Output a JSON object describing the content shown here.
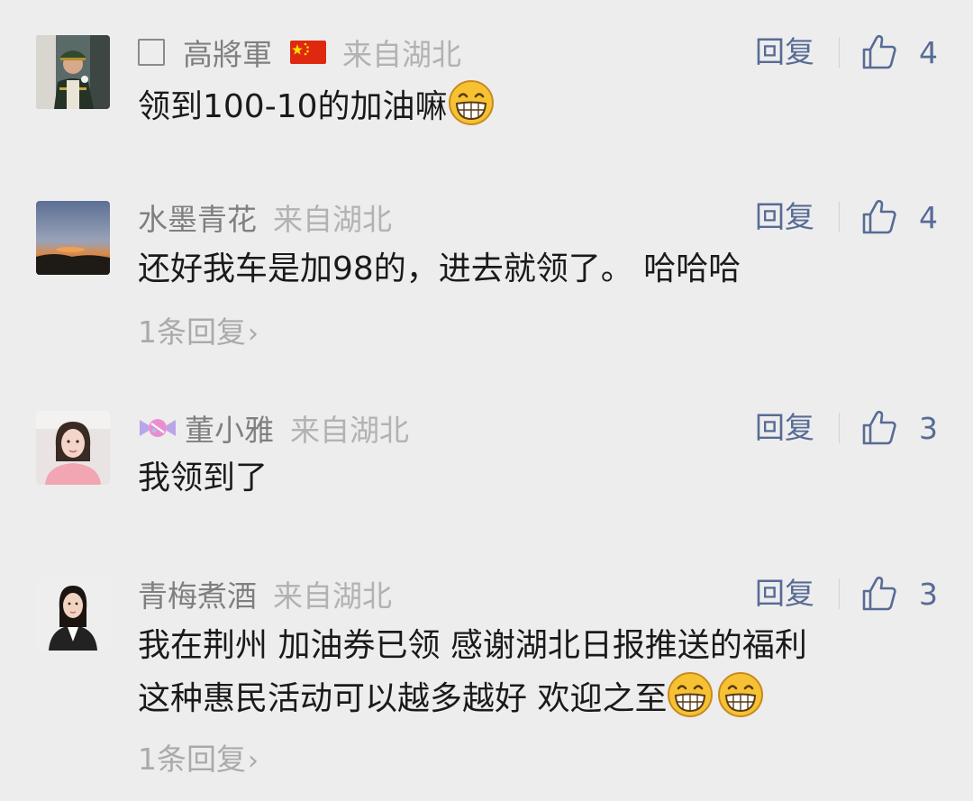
{
  "comments": [
    {
      "name": "高將軍",
      "region": "来自湖北",
      "reply_label": "回复",
      "likes": "4",
      "text": "领到100-10的加油嘛",
      "avatar_icon": "soldier-avatar",
      "name_prefix_icon": "square-icon",
      "name_suffix_icon": "china-flag-icon",
      "emoji_icons": [
        "grin-emoji-icon"
      ]
    },
    {
      "name": "水墨青花",
      "region": "来自湖北",
      "reply_label": "回复",
      "likes": "4",
      "text": "还好我车是加98的，进去就领了。 哈哈哈",
      "sub_reply": "1条回复",
      "avatar_icon": "sunset-avatar"
    },
    {
      "name": "董小雅",
      "region": "来自湖北",
      "reply_label": "回复",
      "likes": "3",
      "text": "我领到了",
      "avatar_icon": "girl-avatar",
      "name_prefix_icon": "candy-icon"
    },
    {
      "name": "青梅煮酒",
      "region": "来自湖北",
      "reply_label": "回复",
      "likes": "3",
      "text_line1": "我在荆州 加油券已领 感谢湖北日报推送的福利",
      "text_line2": "这种惠民活动可以越多越好 欢迎之至",
      "sub_reply": "1条回复",
      "avatar_icon": "woman-avatar",
      "emoji_icons": [
        "grin-emoji-icon",
        "grin-emoji-icon"
      ]
    }
  ],
  "colors": {
    "background": "#ededed",
    "link_blue": "#576b95",
    "name_gray": "#7f7f7f",
    "region_gray": "#b2b2b2",
    "text": "#1a1a1a"
  }
}
